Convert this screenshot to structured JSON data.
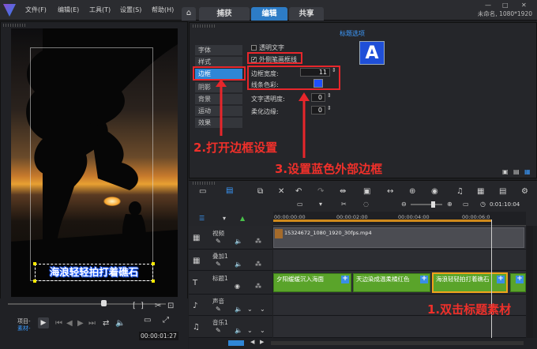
{
  "menu": [
    "文件(F)",
    "编辑(E)",
    "工具(T)",
    "设置(S)",
    "帮助(H)"
  ],
  "tabs": [
    {
      "label": "捕获",
      "active": false
    },
    {
      "label": "编辑",
      "active": true
    },
    {
      "label": "共享",
      "active": false
    }
  ],
  "project_info": "未命名, 1080*1920",
  "options": {
    "header": "标题选项",
    "preview_letter": "A",
    "side_items": [
      {
        "label": "字体",
        "selected": false
      },
      {
        "label": "样式",
        "selected": false
      },
      {
        "label": "边框",
        "selected": true
      },
      {
        "label": "阴影",
        "selected": false
      },
      {
        "label": "背景",
        "selected": false
      },
      {
        "label": "运动",
        "selected": false
      },
      {
        "label": "效果",
        "selected": false
      }
    ],
    "transparent_text": "透明文字",
    "outer_stroke": "外侧笔画框线",
    "border_width_label": "边框宽度:",
    "border_width_value": "11",
    "line_color_label": "线条色彩:",
    "line_color": "#1f4fff",
    "text_transparency_label": "文字透明度:",
    "text_transparency_value": "0",
    "soft_edge_label": "柔化边缘:",
    "soft_edge_value": "0"
  },
  "annotations": {
    "step1": "1.双击标题素材",
    "step2": "2.打开边框设置",
    "step3": "3.设置蓝色外部边框"
  },
  "preview": {
    "title_text": "海浪轻轻拍打着礁石",
    "project_label": "项目-",
    "clip_label": "素材-",
    "timecode": "00:00:01:27"
  },
  "timeline": {
    "ruler": [
      "00:00:00:00",
      "00:00:02:00",
      "00:00:04:00",
      "00:00:06:0"
    ],
    "zoom_time": "0:01:10:04",
    "tracks": [
      {
        "name": "视频"
      },
      {
        "name": "叠加1"
      },
      {
        "name": "标题1"
      },
      {
        "name": "声音"
      },
      {
        "name": "音乐1"
      }
    ],
    "video_clip": "15324672_1080_1920_30fps.mp4",
    "title_clips": [
      "夕阳缓缓沉入海面",
      "天边染成温柔橘红色",
      "海浪轻轻拍打着礁石"
    ]
  }
}
